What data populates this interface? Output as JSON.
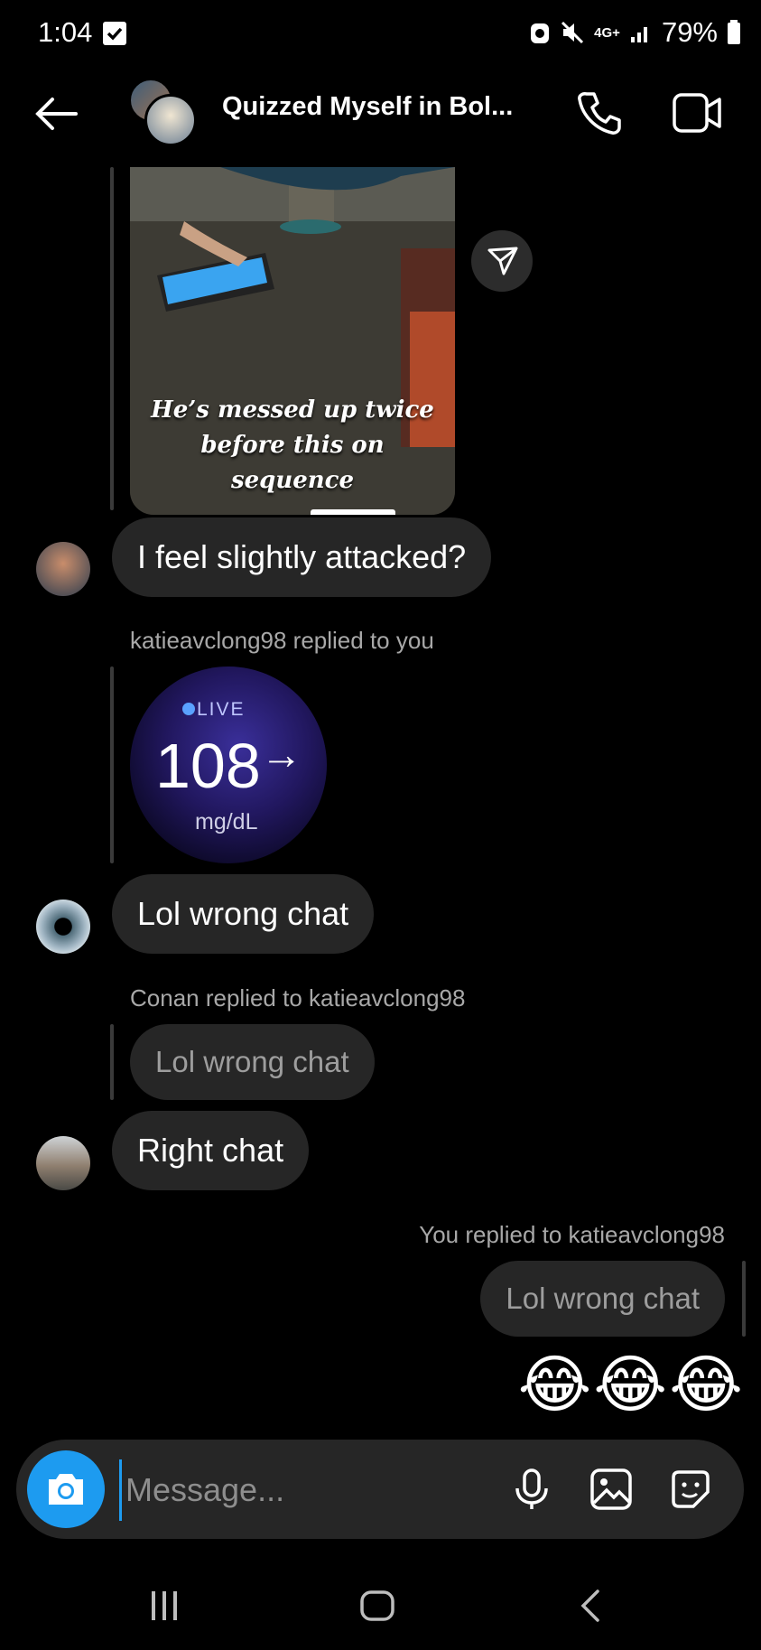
{
  "status_bar": {
    "time": "1:04",
    "network": "4G+",
    "battery": "79%"
  },
  "header": {
    "title": "Quizzed Myself in Bol..."
  },
  "shared_post": {
    "caption_line1": "He’s messed up twice",
    "caption_line2": "before this on",
    "caption_line3": "sequence"
  },
  "messages": [
    {
      "text": "I feel slightly attacked?"
    },
    {
      "reply_meta": "katieavclong98 replied to you"
    },
    {
      "text": "Lol wrong chat"
    },
    {
      "reply_meta": "Conan replied to katieavclong98",
      "quoted": "Lol wrong chat"
    },
    {
      "text": "Right chat"
    },
    {
      "reply_meta": "You replied to katieavclong98",
      "quoted": "Lol wrong chat"
    },
    {
      "text": "😂😂😂"
    }
  ],
  "live_card": {
    "label": "LIVE",
    "value": "108",
    "arrow": "→",
    "unit": "mg/dL"
  },
  "composer": {
    "placeholder": "Message..."
  },
  "colors": {
    "accent": "#1d9bf0",
    "bubble": "#262626",
    "meta_text": "#a8a8a8"
  }
}
